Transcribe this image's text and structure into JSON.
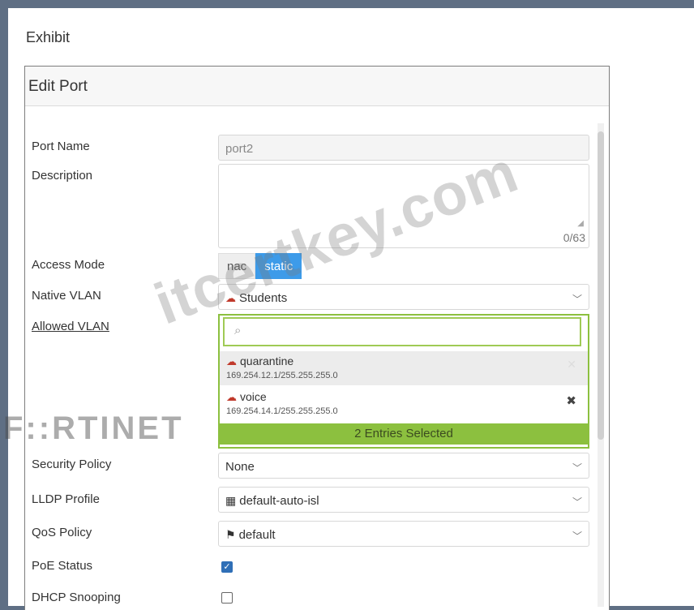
{
  "exhibit": {
    "title": "Exhibit"
  },
  "dialog": {
    "title": "Edit Port",
    "port_name": {
      "label": "Port Name",
      "value": "port2"
    },
    "description": {
      "label": "Description",
      "value": "",
      "counter": "0/63"
    },
    "access_mode": {
      "label": "Access Mode",
      "options": [
        "nac",
        "static"
      ],
      "selected": "static"
    },
    "native_vlan": {
      "label": "Native VLAN",
      "value": "Students",
      "icon": "cloud-icon"
    },
    "allowed_vlan": {
      "label": "Allowed VLAN",
      "search_placeholder": "",
      "entries": [
        {
          "name": "quarantine",
          "address": "169.254.12.1/255.255.255.0"
        },
        {
          "name": "voice",
          "address": "169.254.14.1/255.255.255.0"
        }
      ],
      "selected_summary": "2 Entries Selected"
    },
    "security_policy": {
      "label": "Security Policy",
      "value": "None"
    },
    "lldp_profile": {
      "label": "LLDP Profile",
      "value": "default-auto-isl",
      "icon": "table-icon"
    },
    "qos_policy": {
      "label": "QoS Policy",
      "value": "default",
      "icon": "flag-icon"
    },
    "poe_status": {
      "label": "PoE Status",
      "checked": true
    },
    "dhcp_snooping": {
      "label": "DHCP Snooping",
      "checked": false
    }
  },
  "watermarks": {
    "site": "itcertkey.com",
    "logo": "F::RTINET"
  },
  "colors": {
    "accent_blue": "#3d9be9",
    "selection_green": "#8cc03f",
    "vlan_icon_red": "#c0392b"
  }
}
